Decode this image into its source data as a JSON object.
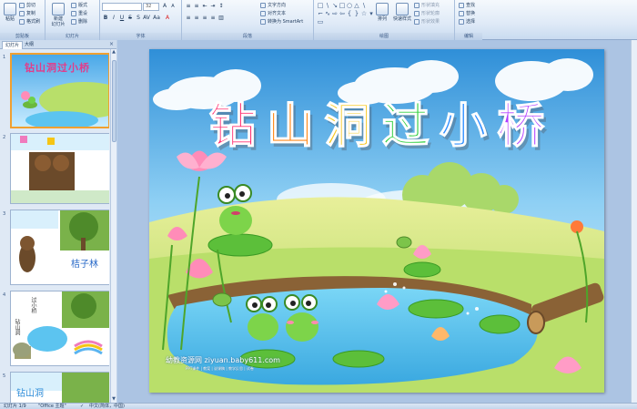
{
  "ribbon": {
    "clipboard": {
      "label": "剪贴板",
      "paste": "粘贴",
      "cut": "剪切",
      "copy": "复制",
      "format_painter": "格式刷"
    },
    "slides": {
      "label": "幻灯片",
      "new_slide": "新建\n幻灯片",
      "layout": "版式",
      "reset": "重设",
      "delete": "删除"
    },
    "font": {
      "label": "字体",
      "font_name": "",
      "font_size": "32"
    },
    "paragraph": {
      "label": "段落",
      "text_direction": "文字方向",
      "align_text": "对齐文本",
      "smartart": "转换为 SmartArt"
    },
    "drawing": {
      "label": "绘图",
      "arrange": "排列",
      "quick_styles": "快速样式",
      "shape_fill": "形状填充",
      "shape_outline": "形状轮廓",
      "shape_effects": "形状效果"
    },
    "editing": {
      "label": "编辑",
      "find": "查找",
      "replace": "替换",
      "select": "选择"
    }
  },
  "pane": {
    "tab_slides": "幻灯片",
    "tab_outline": "大纲",
    "close": "×"
  },
  "thumbnails": [
    {
      "num": "1",
      "title": "钻山洞过小桥"
    },
    {
      "num": "2",
      "title": ""
    },
    {
      "num": "3",
      "label": "桔子林"
    },
    {
      "num": "4",
      "label_a": "过小桥",
      "label_b": "钻山洞"
    },
    {
      "num": "5",
      "label": "钻山洞"
    }
  ],
  "slide": {
    "title": "钻山洞过小桥",
    "title_colors": [
      "#ff2a6d",
      "#ff8a1c",
      "#f6c514",
      "#2ecf3c",
      "#2a8cff",
      "#b03cff"
    ],
    "watermark": "幼教资源网 ziyuan.baby611.com",
    "watermark_sub": "PPT课件 | 教案 | 说课稿 | 教学反思 | 试卷"
  },
  "statusbar": {
    "slide_info": "幻灯片 1/9",
    "theme": "\"Office 主题\"",
    "language": "中文(简体，中国)"
  }
}
